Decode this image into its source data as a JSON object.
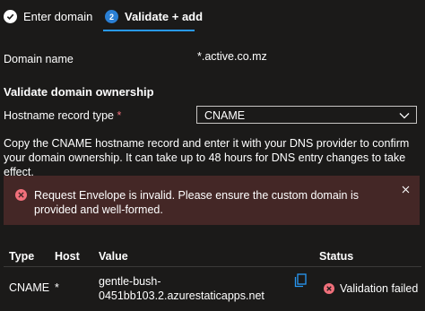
{
  "steps": [
    {
      "label": "Enter domain",
      "state": "complete",
      "icon": "check-circle-icon"
    },
    {
      "label": "Validate + add",
      "state": "active",
      "number": "2"
    }
  ],
  "domain": {
    "label": "Domain name",
    "value": "*.active.co.mz"
  },
  "validate_section": {
    "title": "Validate domain ownership"
  },
  "record_type": {
    "label": "Hostname record type",
    "required_marker": "*",
    "value": "CNAME"
  },
  "description": "Copy the CNAME hostname record and enter it with your DNS provider to confirm your domain ownership. It can take up to 48 hours for DNS entry changes to take effect.",
  "error": {
    "message": "Request Envelope is invalid.  Please ensure the custom domain is provided and well-formed.",
    "background": "#442726",
    "icon_color": "#f1707b"
  },
  "table": {
    "headers": {
      "type": "Type",
      "host": "Host",
      "value": "Value",
      "status": "Status"
    },
    "row": {
      "type": "CNAME",
      "host": "*",
      "value_line1": "gentle-bush-",
      "value_line2": "0451bb103.2.azurestaticapps.net",
      "status": "Validation failed"
    }
  },
  "colors": {
    "accent": "#2899f5",
    "background": "#1b1a19",
    "error_red": "#f1707b"
  }
}
